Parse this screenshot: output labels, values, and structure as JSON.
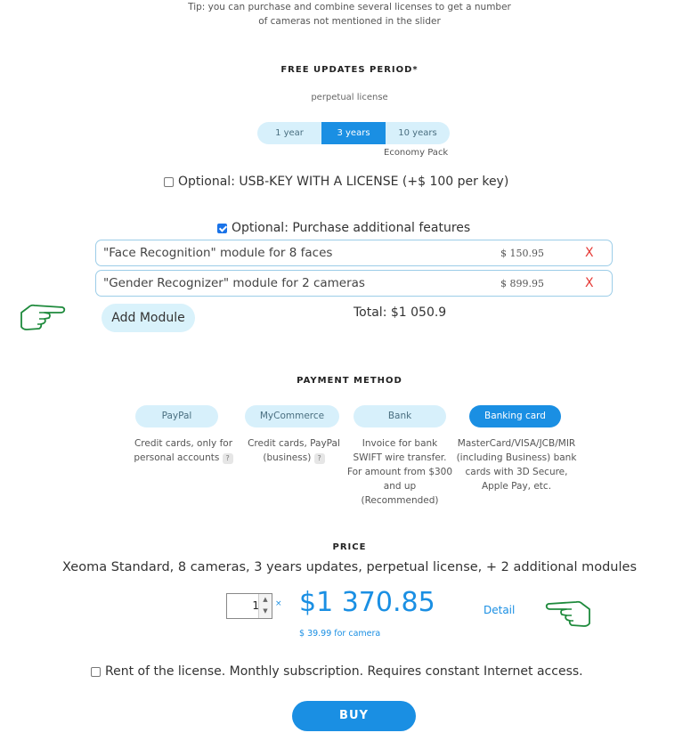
{
  "tip": {
    "line1": "Tip: you can purchase and combine several licenses to get a number",
    "line2": "of cameras not mentioned in the slider"
  },
  "updates": {
    "title": "FREE UPDATES PERIOD*",
    "subtitle": "perpetual license",
    "options": [
      "1 year",
      "3 years",
      "10 years"
    ],
    "selected": "3 years",
    "pack_note": "Economy Pack"
  },
  "usb_key": {
    "checked": false,
    "label": "Optional: USB-KEY WITH A LICENSE (+$ 100 per key)"
  },
  "features": {
    "checked": true,
    "label": "Optional: Purchase additional features",
    "modules": [
      {
        "name": "\"Face Recognition\" module for 8 faces",
        "price": "$ 150.95",
        "remove": "X"
      },
      {
        "name": "\"Gender Recognizer\" module for 2 cameras",
        "price": "$ 899.95",
        "remove": "X"
      }
    ],
    "add_button": "Add Module",
    "total": "Total: $1 050.9"
  },
  "payment": {
    "title": "PAYMENT METHOD",
    "methods": [
      {
        "label": "PayPal",
        "active": false,
        "desc": [
          "Credit cards, only for",
          "personal accounts"
        ],
        "help": "?"
      },
      {
        "label": "MyCommerce",
        "active": false,
        "desc": [
          "Credit cards, PayPal",
          "(business)"
        ],
        "help": "?"
      },
      {
        "label": "Bank",
        "active": false,
        "desc": [
          "Invoice for bank",
          "SWIFT wire transfer.",
          "For amount from $300",
          "and up",
          "(Recommended)"
        ]
      },
      {
        "label": "Banking card",
        "active": true,
        "desc": [
          "MasterCard/VISA/JCB/MIR",
          "(including Business) bank",
          "cards with 3D Secure,",
          "Apple Pay, etc."
        ]
      }
    ]
  },
  "price": {
    "title": "PRICE",
    "summary": "Xeoma Standard, 8 cameras, 3 years updates, perpetual license, + 2 additional modules",
    "quantity": "1",
    "multiply": "×",
    "amount": "$1 370.85",
    "detail_link": "Detail",
    "per_camera": "$ 39.99 for camera"
  },
  "rent": {
    "checked": false,
    "label": "Rent of the license. Monthly subscription. Requires constant Internet access."
  },
  "buy_button": "BUY",
  "colors": {
    "accent": "#1a8fe3",
    "pill_bg": "#d7f0fb",
    "hand_icon": "#1e8a3c",
    "remove": "#e53935"
  },
  "icons": [
    "pointing-hand-right-icon",
    "pointing-hand-left-icon",
    "spinner-up-icon",
    "spinner-down-icon"
  ]
}
